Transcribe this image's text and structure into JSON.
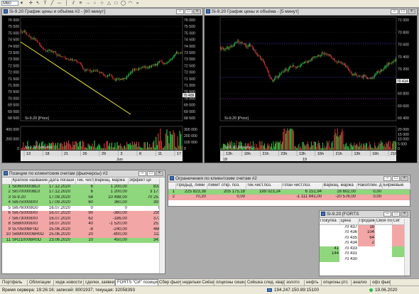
{
  "toolbar": {
    "timeframe": "M60",
    "icons": [
      "crosshair-icon",
      "arrow-icon",
      "text-icon",
      "line-icon",
      "hline-icon",
      "vline-icon",
      "channel-icon",
      "fibo-icon",
      "ray-icon",
      "circle-icon",
      "star-icon",
      "triangle-icon",
      "rect-icon",
      "ellipse-icon",
      "arc-icon",
      "more-icon"
    ]
  },
  "chart1": {
    "title": "Si-9.20 График цены и объёма #2 - [60 минут]",
    "price_ticks": [
      "76 000",
      "75 500",
      "75 000",
      "74 500",
      "74 000",
      "73 500",
      "73 000",
      "72 500",
      "72 000",
      "71 500",
      "71 000",
      "70 500",
      "70 000",
      "69 500",
      "69 000",
      "68 500"
    ],
    "price_label": "Si-9.20 [Price]",
    "last_price": "70 409",
    "volume_ticks": [
      "400 000",
      "200 000",
      "0"
    ],
    "volume_ticks_right": [
      "300 000",
      "200 000",
      "100 000",
      "0"
    ],
    "volume_label": "Si-9.20 [Volume]",
    "date_ticks": [
      "13",
      "18",
      "21",
      "26",
      "29",
      "3",
      "8",
      "11",
      "17"
    ],
    "month_label": "Jun"
  },
  "chart2": {
    "title": "Si-9.20 График цены и объёма - [5 минут]",
    "price_ticks": [
      "71 000",
      "70 800",
      "70 600",
      "70 400",
      "70 200",
      "70 000",
      "69 800",
      "69 600",
      "69 400"
    ],
    "price_label": "Si-9.20 [Price]",
    "last_price": "70 414",
    "volume_ticks": [
      "20 000",
      "15 000",
      "10 000",
      "5 000",
      "0"
    ],
    "volume_label": "Si-9.20 [Volume]",
    "time_ticks": [
      "13h",
      "16h",
      "21h",
      "23h",
      "13h",
      "16h",
      "21h",
      "13h",
      "16h",
      "21h"
    ],
    "day_labels": [
      "18",
      "19"
    ]
  },
  "positions": {
    "title": "Позиции по клиентским счетам (фьючерсы) #2",
    "columns": [
      "",
      "Краткое название",
      "Дата погаше",
      "Тек. чист",
      "Вариац. маржа",
      "Эффект це"
    ],
    "rows": [
      {
        "n": "1",
        "name": "Si0600000BL0",
        "date": "17.12.2020",
        "net": "6",
        "var": "1 200,00",
        "eff": "832",
        "c": "g"
      },
      {
        "n": "2",
        "name": "Si0700000BL0",
        "date": "17.12.2020",
        "net": "6",
        "var": "1 200,00",
        "eff": "3 171",
        "c": "g"
      },
      {
        "n": "3",
        "name": "Si-9.20",
        "date": "17.09.2020",
        "net": "58",
        "var": "10 498,00",
        "eff": "70 257",
        "c": "g"
      },
      {
        "n": "4",
        "name": "Si6750008X0",
        "date": "17.09.2020",
        "net": "60",
        "var": "360,00",
        "eff": "391",
        "c": "g"
      },
      {
        "n": "5",
        "name": "Si6760008G0",
        "date": "16.07.2020",
        "net": "0",
        "var": "0",
        "eff": "0",
        "c": "n"
      },
      {
        "n": "6",
        "name": "Si6750008X0",
        "date": "16.07.2020",
        "net": "90",
        "var": "-360,00",
        "eff": "295",
        "c": "r"
      },
      {
        "n": "7",
        "name": "Si6730008X0",
        "date": "16.07.2020",
        "net": "62",
        "var": "-186,00",
        "eff": "372",
        "c": "r"
      },
      {
        "n": "8",
        "name": "Si6800008X0",
        "date": "16.07.2020",
        "net": "40",
        "var": "-1 520,00",
        "eff": "257",
        "c": "r"
      },
      {
        "n": "9",
        "name": "Si70500BF0D",
        "date": "25.06.2020",
        "net": "-8",
        "var": "-240,00",
        "eff": "466",
        "c": "r"
      },
      {
        "n": "10",
        "name": "Si6900000BR0D",
        "date": "25.06.2020",
        "net": "20",
        "var": "-800,00",
        "eff": "112",
        "c": "r"
      },
      {
        "n": "11",
        "name": "SR21000BR0D",
        "date": "23.06.2020",
        "net": "10",
        "var": "450,00",
        "eff": "341",
        "c": "g"
      }
    ]
  },
  "limits": {
    "title": "Ограничения по клиентским счетам #2",
    "columns": [
      "",
      "Предыд. лими",
      "Лимит откр. поз.",
      "Тек.чист.поз.",
      "План чист.поз.",
      "Вариац. маржа",
      "Накоплен. д",
      "Биржевые"
    ],
    "rows": [
      {
        "n": "1",
        "prev": "225 823,38",
        "lim": "205 175,18",
        "cur": "199 023,24",
        "plan": "6 151,94",
        "var": "16 602,00",
        "acc": "0,00",
        "ex": "",
        "c": "g"
      },
      {
        "n": "2",
        "prev": "70,20",
        "lim": "0,00",
        "cur": "",
        "plan": "-1 111 941,00",
        "var": "-20 578,00",
        "acc": "0,00",
        "ex": "",
        "c": "r"
      }
    ]
  },
  "orderbook": {
    "title": "Si-9.20 [FORTS",
    "columns": [
      "Покупка",
      "Цена",
      "Продажа",
      "Своя по",
      "Сиг"
    ],
    "rows": [
      {
        "buy": "",
        "price": "70 437",
        "sell": "16",
        "c": "r"
      },
      {
        "buy": "",
        "price": "70 436",
        "sell": "104",
        "c": "r"
      },
      {
        "buy": "",
        "price": "70 435",
        "sell": "64",
        "c": "r"
      },
      {
        "buy": "",
        "price": "70 434",
        "sell": "2",
        "c": "r"
      },
      {
        "buy": "41",
        "price": "70 433",
        "sell": "",
        "c": "g"
      },
      {
        "buy": "144",
        "price": "70 431",
        "sell": "",
        "c": "g"
      },
      {
        "buy": "",
        "price": "70 430",
        "sell": "",
        "c": "g"
      }
    ]
  },
  "tabs": [
    "Портфель",
    "Облигации",
    "хедж новости",
    "сделки, заявки",
    "FORTS \"СИ\" позиция",
    "Сбер фьюч",
    "недельки Сиёшка",
    "опционы сишка",
    "Сиёшка след. квартал",
    "золото",
    "нефть",
    "опционы ртс",
    "анализ",
    "офз фьючи"
  ],
  "active_tab": 4,
  "status": {
    "server_time": "Время сервера: 19:26:16; записей: 8001937; текущая: 32058393",
    "ip": "194.247.150.89:15100",
    "date": "19.06.2020"
  }
}
